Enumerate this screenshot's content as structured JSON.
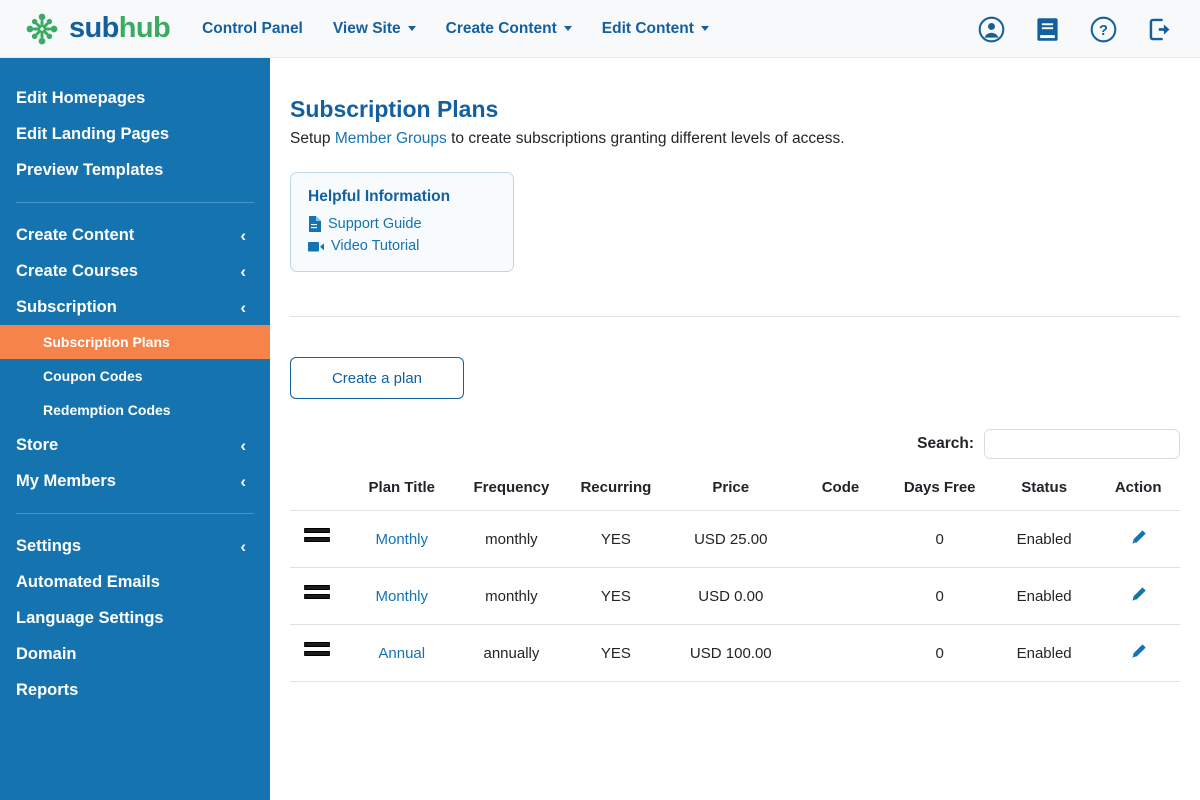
{
  "brand": {
    "part1": "sub",
    "part2": "hub",
    "logo_icon": "starburst-logo-icon"
  },
  "topnav": {
    "items": [
      {
        "label": "Control Panel",
        "dropdown": false
      },
      {
        "label": "View Site",
        "dropdown": true
      },
      {
        "label": "Create Content",
        "dropdown": true
      },
      {
        "label": "Edit Content",
        "dropdown": true
      }
    ],
    "icons": [
      {
        "name": "account-icon"
      },
      {
        "name": "book-icon"
      },
      {
        "name": "help-icon"
      },
      {
        "name": "logout-icon"
      }
    ]
  },
  "sidebar": {
    "group1": [
      {
        "label": "Edit Homepages",
        "expandable": false
      },
      {
        "label": "Edit Landing Pages",
        "expandable": false
      },
      {
        "label": "Preview Templates",
        "expandable": false
      }
    ],
    "group2": [
      {
        "label": "Create Content",
        "expandable": true
      },
      {
        "label": "Create Courses",
        "expandable": true
      },
      {
        "label": "Subscription",
        "expandable": true
      }
    ],
    "subitems": [
      {
        "label": "Subscription Plans",
        "active": true
      },
      {
        "label": "Coupon Codes",
        "active": false
      },
      {
        "label": "Redemption Codes",
        "active": false
      }
    ],
    "group3": [
      {
        "label": "Store",
        "expandable": true
      },
      {
        "label": "My Members",
        "expandable": true
      }
    ],
    "group4": [
      {
        "label": "Settings",
        "expandable": true
      },
      {
        "label": "Automated Emails",
        "expandable": false
      },
      {
        "label": "Language Settings",
        "expandable": false
      },
      {
        "label": "Domain",
        "expandable": false
      },
      {
        "label": "Reports",
        "expandable": false
      }
    ],
    "chevron_glyph": "‹",
    "active_color": "#f5834a",
    "background_color": "#1573b0"
  },
  "main": {
    "title": "Subscription Plans",
    "subtitle_before": "Setup ",
    "subtitle_link": "Member Groups",
    "subtitle_after": " to create subscriptions granting different levels of access.",
    "info_card": {
      "title": "Helpful Information",
      "links": [
        {
          "label": "Support Guide",
          "icon": "document-icon"
        },
        {
          "label": "Video Tutorial",
          "icon": "video-icon"
        }
      ]
    },
    "create_button": "Create a plan",
    "search": {
      "label": "Search:",
      "value": "",
      "placeholder": ""
    },
    "table": {
      "headers": [
        "",
        "Plan Title",
        "Frequency",
        "Recurring",
        "Price",
        "Code",
        "Days Free",
        "Status",
        "Action"
      ],
      "rows": [
        {
          "title": "Monthly",
          "frequency": "monthly",
          "recurring": "YES",
          "price": "USD 25.00",
          "code": "",
          "days_free": "0",
          "status": "Enabled",
          "action_icon": "edit-pencil-icon"
        },
        {
          "title": "Monthly",
          "frequency": "monthly",
          "recurring": "YES",
          "price": "USD 0.00",
          "code": "",
          "days_free": "0",
          "status": "Enabled",
          "action_icon": "edit-pencil-icon"
        },
        {
          "title": "Annual",
          "frequency": "annually",
          "recurring": "YES",
          "price": "USD 100.00",
          "code": "",
          "days_free": "0",
          "status": "Enabled",
          "action_icon": "edit-pencil-icon"
        }
      ]
    }
  },
  "colors": {
    "brand_blue": "#14609f",
    "brand_green": "#3aab63",
    "sidebar_blue": "#1573b0",
    "accent_orange": "#f5834a",
    "link_blue": "#1573b0"
  }
}
